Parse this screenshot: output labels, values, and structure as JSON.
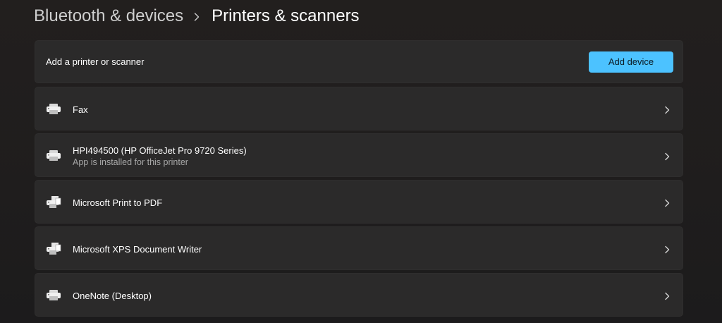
{
  "breadcrumb": {
    "parent": "Bluetooth & devices",
    "current": "Printers & scanners"
  },
  "add_section": {
    "label": "Add a printer or scanner",
    "button_label": "Add device"
  },
  "devices": [
    {
      "name": "Fax",
      "subtitle": "",
      "icon": "fax-printer-icon"
    },
    {
      "name": "HPI494500 (HP OfficeJet Pro 9720 Series)",
      "subtitle": "App is installed for this printer",
      "icon": "printer-icon"
    },
    {
      "name": "Microsoft Print to PDF",
      "subtitle": "",
      "icon": "printer-document-icon"
    },
    {
      "name": "Microsoft XPS Document Writer",
      "subtitle": "",
      "icon": "printer-document-icon"
    },
    {
      "name": "OneNote (Desktop)",
      "subtitle": "",
      "icon": "printer-icon"
    }
  ],
  "colors": {
    "accent": "#4cc2ff",
    "background": "#1f1e1e",
    "card": "#2b2a2a",
    "secondary_text": "#a7a7a7"
  }
}
